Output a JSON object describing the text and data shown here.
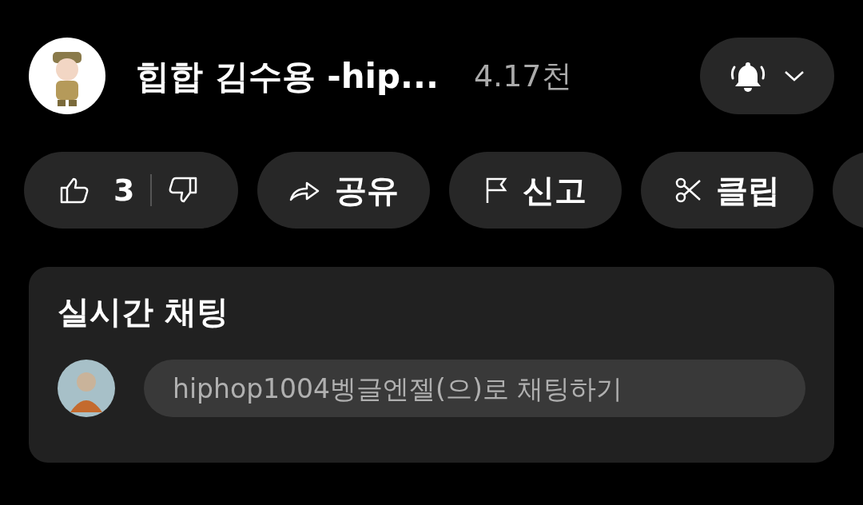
{
  "channel": {
    "name": "힙합 김수용 -hip...",
    "subscribers": "4.17천"
  },
  "notification_button": {
    "kind": "bell"
  },
  "actions": [
    {
      "kind": "like",
      "count": "3"
    },
    {
      "kind": "share",
      "label": "공유"
    },
    {
      "kind": "report",
      "label": "신고"
    },
    {
      "kind": "clip",
      "label": "클립"
    },
    {
      "kind": "partial"
    }
  ],
  "live_chat": {
    "title": "실시간 채팅",
    "input": {
      "placeholder": "hiphop1004벵글엔젤(으)로 채팅하기"
    }
  }
}
